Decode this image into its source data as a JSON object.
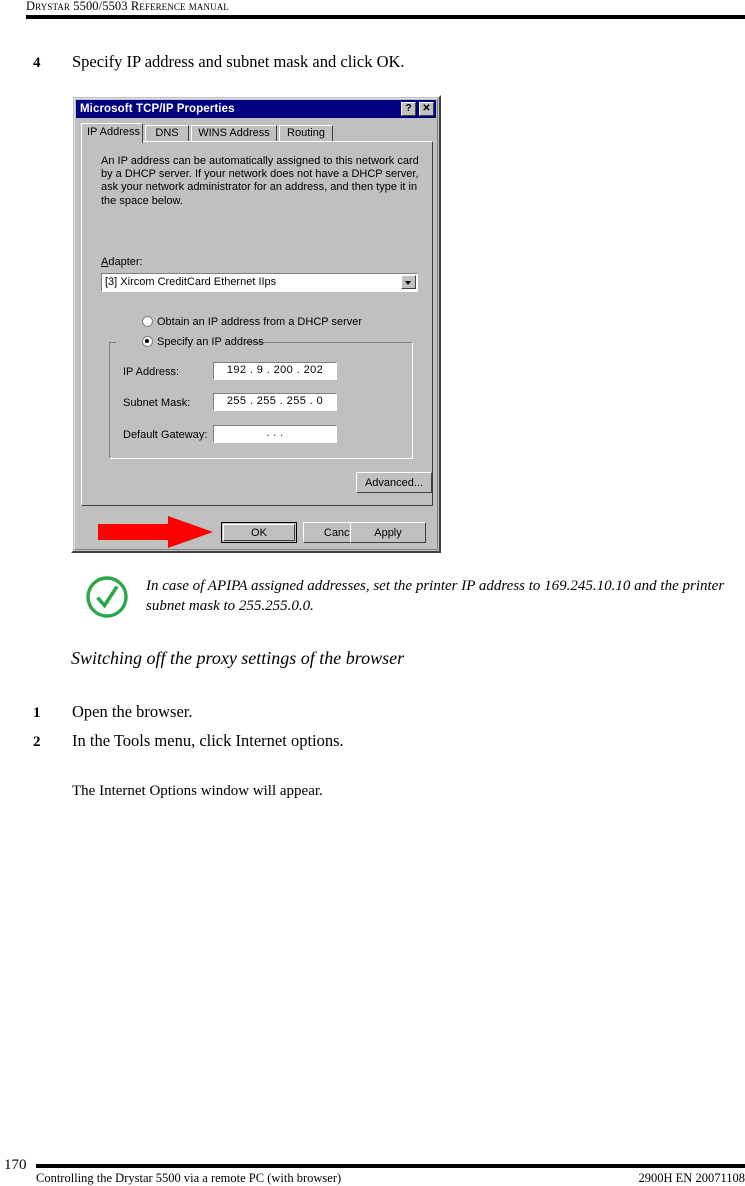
{
  "page": {
    "header_title": "Drystar 5500/5503 Reference manual",
    "footer_page_number": "170",
    "footer_left": "Controlling the Drystar 5500 via a remote PC (with browser)",
    "footer_right": "2900H EN 20071108"
  },
  "steps": {
    "step4_number": "4",
    "step4_text": "Specify IP address and subnet mask and click OK.",
    "step1_number": "1",
    "step1_text": "Open the browser.",
    "step2_number": "2",
    "step2_text": "In the Tools menu, click Internet options.",
    "step2_sub_text": "The Internet Options window will appear."
  },
  "note": {
    "icon": "green-check-circle-icon",
    "icon_color": "#2aa84a",
    "text": "In case of APIPA assigned addresses, set the printer IP address to 169.245.10.10 and the printer subnet mask to 255.255.0.0."
  },
  "section_heading": "Switching off the proxy settings of the browser",
  "dialog": {
    "title": "Microsoft TCP/IP Properties",
    "titlebar_color": "#000080",
    "face_color": "#c0c0c0",
    "help_button_label": "?",
    "close_button_label": "✕",
    "tabs": [
      {
        "label": "IP Address",
        "active": true
      },
      {
        "label": "DNS",
        "active": false
      },
      {
        "label": "WINS Address",
        "active": false
      },
      {
        "label": "Routing",
        "active": false
      }
    ],
    "body_text": "An IP address can be automatically assigned to this network card by a DHCP server.  If your network does not have a DHCP server, ask your network administrator for an address, and then type it in the space below.",
    "adapter_label": "Adapter:",
    "adapter_value": "[3] Xircom CreditCard Ethernet IIps",
    "radio_dhcp_label": "Obtain an IP address from a DHCP server",
    "radio_dhcp_selected": false,
    "radio_specify_label": "Specify an IP address",
    "radio_specify_selected": true,
    "fields": [
      {
        "label": "IP Address:",
        "value": "192 .  9  . 200 . 202"
      },
      {
        "label": "Subnet Mask:",
        "value": "255 . 255 . 255 .  0"
      },
      {
        "label": "Default Gateway:",
        "value": "  .     .     ."
      }
    ],
    "buttons": {
      "advanced": "Advanced...",
      "ok": "OK",
      "cancel": "Cancel",
      "apply": "Apply"
    }
  },
  "callout": {
    "arrow_color": "#fe0000",
    "points_to": "ok-button"
  }
}
